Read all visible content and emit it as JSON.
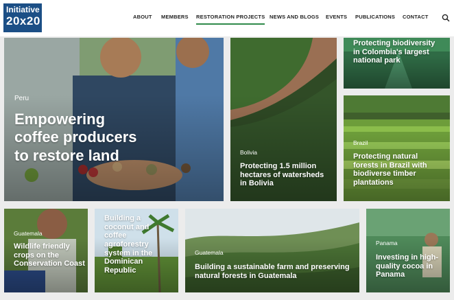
{
  "logo": {
    "line1": "Initiative",
    "line2": "20x20"
  },
  "nav": [
    {
      "label": "ABOUT"
    },
    {
      "label": "MEMBERS"
    },
    {
      "label": "RESTORATION PROJECTS",
      "active": true
    },
    {
      "label": "NEWS AND BLOGS"
    },
    {
      "label": "EVENTS"
    },
    {
      "label": "PUBLICATIONS"
    },
    {
      "label": "CONTACT"
    }
  ],
  "colors": {
    "logo_bg": "#1c4f86",
    "nav_active": "#2f8a4a"
  },
  "tiles": {
    "peru": {
      "tag": "Peru",
      "title": "Empowering coffee producers to restore land"
    },
    "bolivia": {
      "tag": "Bolivia",
      "title": "Protecting 1.5 million hectares of watersheds in Bolivia"
    },
    "colombia": {
      "tag": "",
      "title": "Protecting biodiversity in Colombia's largest national park"
    },
    "brazil": {
      "tag": "Brazil",
      "title": "Protecting natural forests in Brazil with biodiverse timber plantations"
    },
    "guatemala1": {
      "tag": "Guatemala",
      "title": "Wildlife friendly crops on the Conservation Coast"
    },
    "dominican": {
      "tag": "",
      "title": "Building a coconut and coffee agroforestry system in the Dominican Republic"
    },
    "guatemala2": {
      "tag": "Guatemala",
      "title": "Building a sustainable farm and preserving natural forests in Guatemala"
    },
    "panama": {
      "tag": "Panama",
      "title": "Investing in high-quality cocoa in Panama"
    }
  }
}
